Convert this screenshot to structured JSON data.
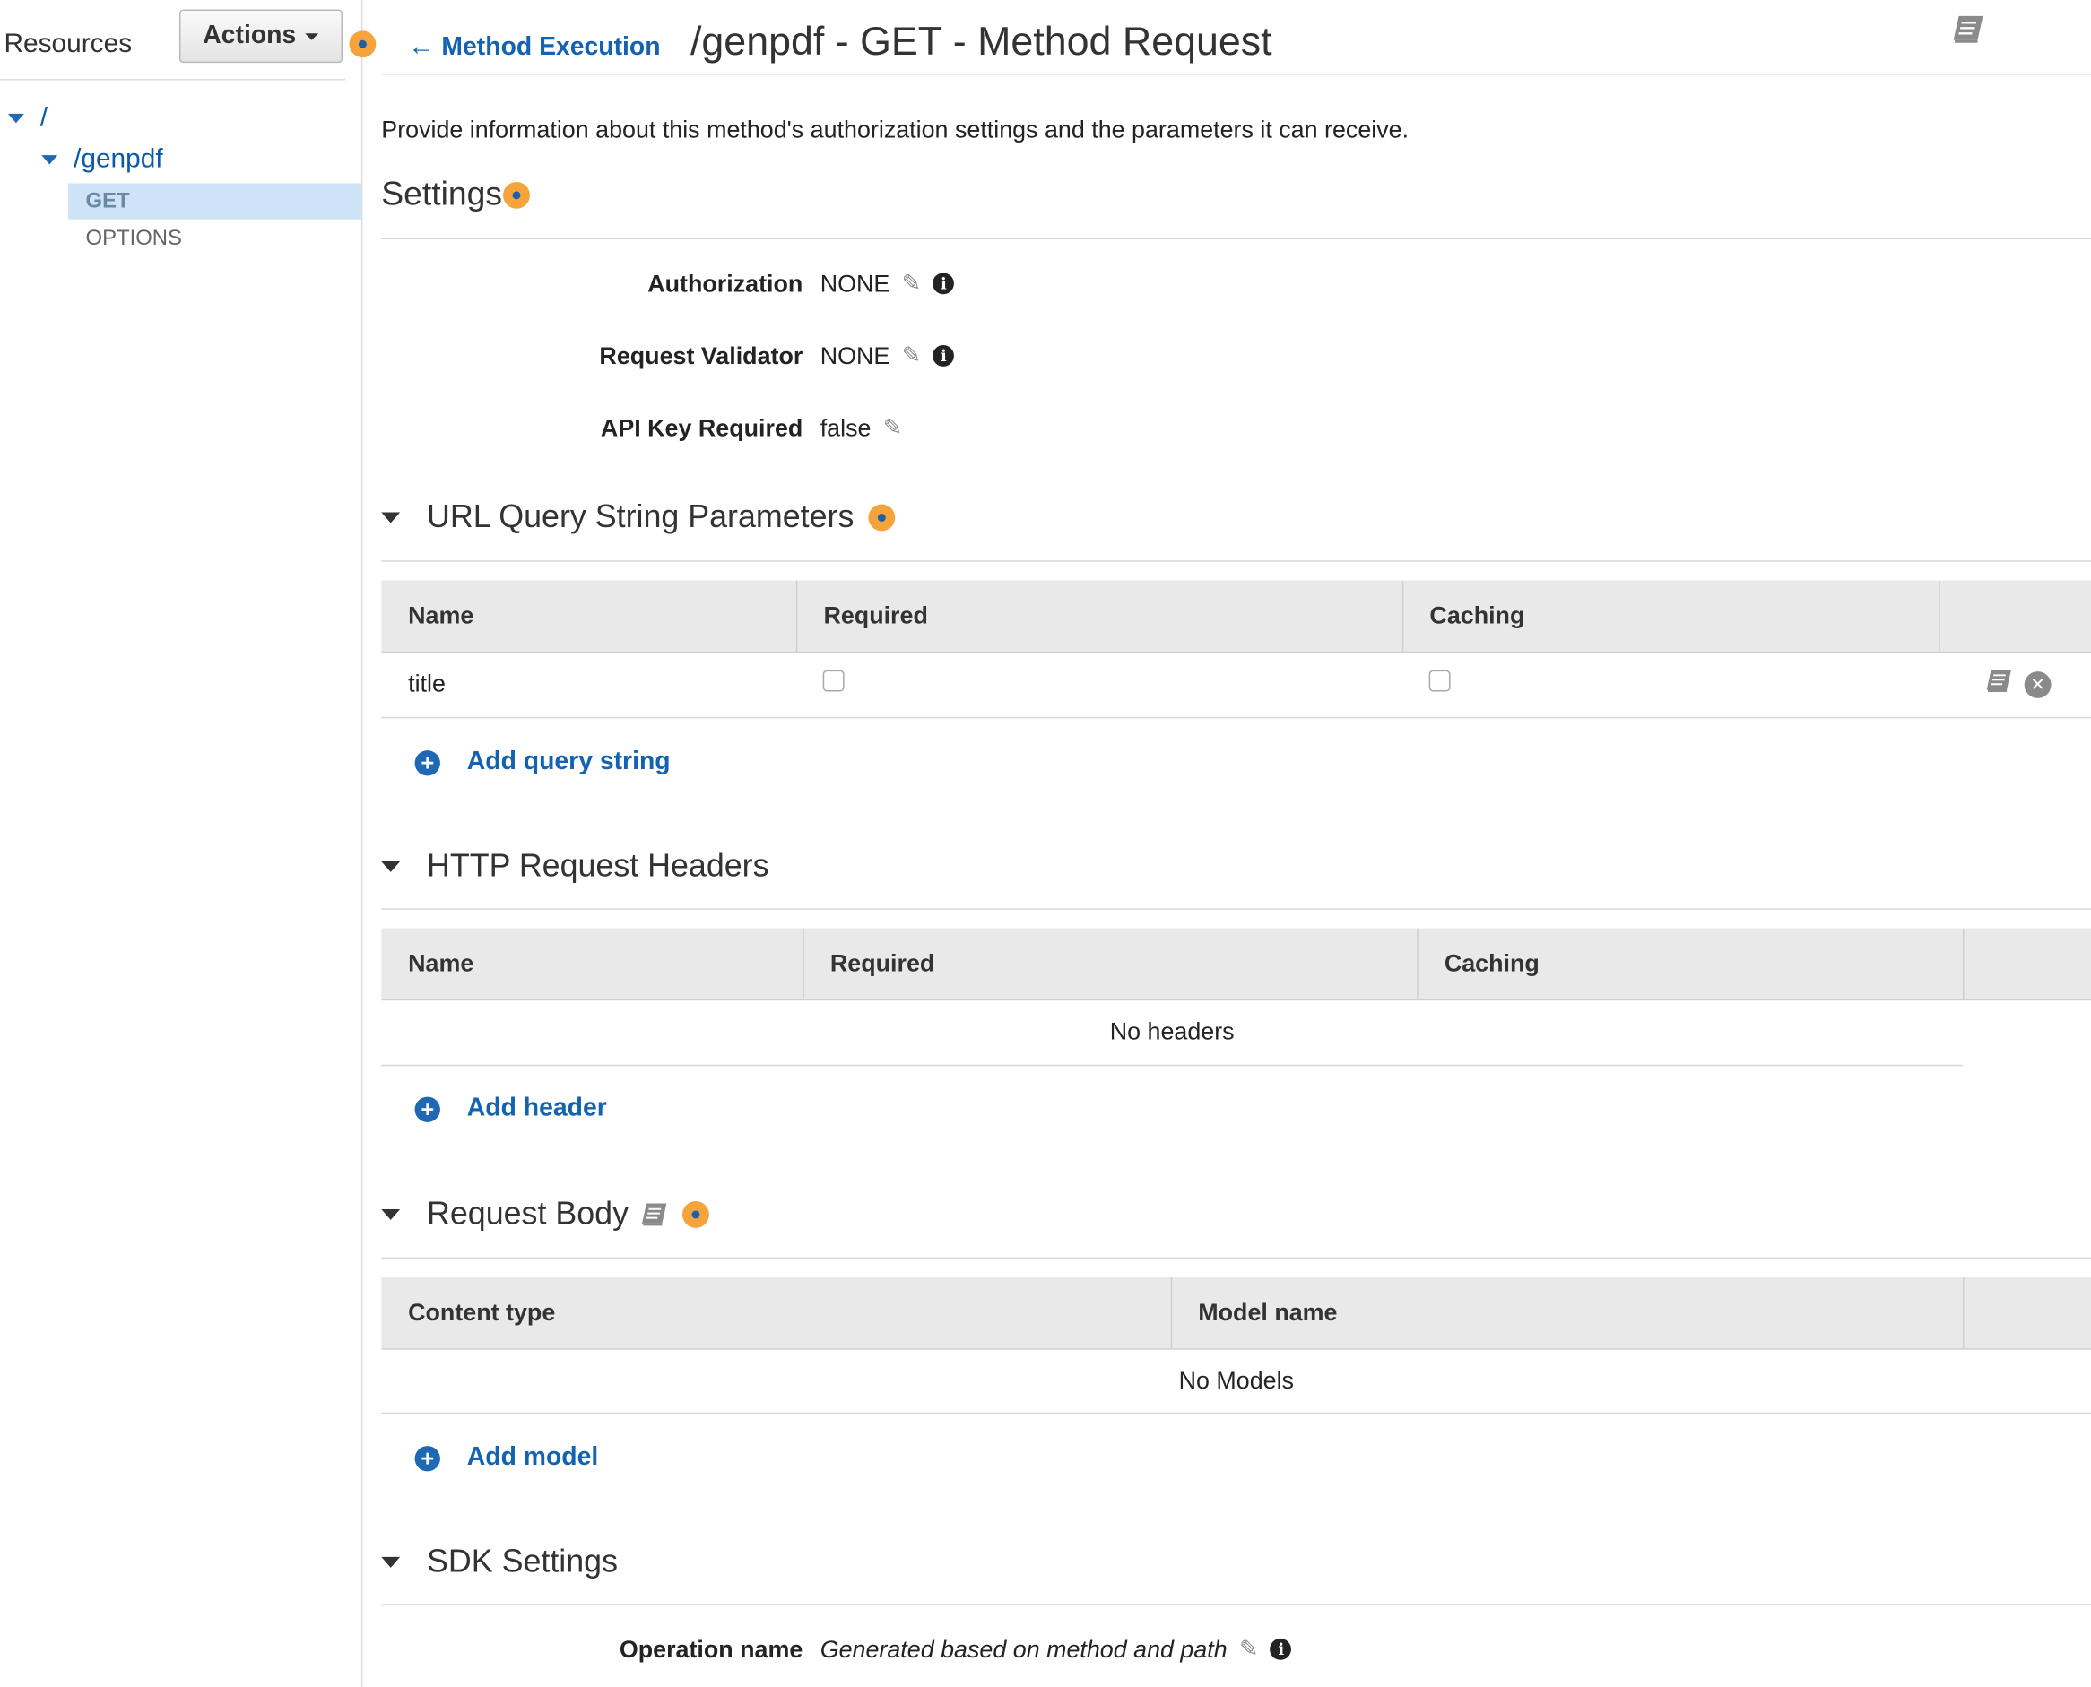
{
  "sidebar": {
    "title": "Resources",
    "actions_label": "Actions",
    "tree": {
      "root": "/",
      "resource": "/genpdf",
      "methods": [
        "GET",
        "OPTIONS"
      ]
    }
  },
  "header": {
    "back_label": "Method Execution",
    "title": "/genpdf - GET - Method Request"
  },
  "description": "Provide information about this method's authorization settings and the parameters it can receive.",
  "settings": {
    "heading": "Settings",
    "authorization_label": "Authorization",
    "authorization_value": "NONE",
    "validator_label": "Request Validator",
    "validator_value": "NONE",
    "api_key_label": "API Key Required",
    "api_key_value": "false"
  },
  "query_params": {
    "heading": "URL Query String Parameters",
    "columns": [
      "Name",
      "Required",
      "Caching"
    ],
    "rows": [
      {
        "name": "title",
        "required": false,
        "caching": false
      }
    ],
    "add_label": "Add query string"
  },
  "headers": {
    "heading": "HTTP Request Headers",
    "columns": [
      "Name",
      "Required",
      "Caching"
    ],
    "empty_text": "No headers",
    "add_label": "Add header"
  },
  "body": {
    "heading": "Request Body",
    "columns": [
      "Content type",
      "Model name"
    ],
    "empty_text": "No Models",
    "add_label": "Add model"
  },
  "sdk": {
    "heading": "SDK Settings",
    "operation_label": "Operation name",
    "operation_value": "Generated based on method and path"
  },
  "colors": {
    "link_blue": "#1463b3",
    "help_orange": "#f5a33b",
    "selected_bg": "#cfe3f6",
    "header_bg": "#e9e9e9"
  },
  "icons": [
    "help-icon",
    "back-arrow-icon",
    "book-icon",
    "pencil-icon",
    "info-icon",
    "triangle-down-icon",
    "add-icon",
    "remove-icon",
    "checkbox"
  ]
}
